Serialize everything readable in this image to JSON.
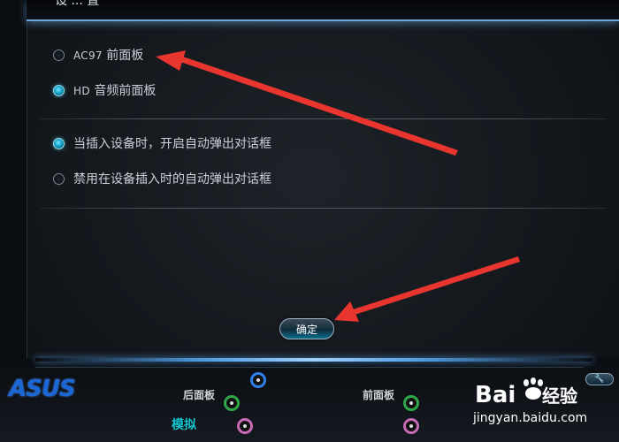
{
  "window": {
    "title_fragment": "设 ... 置"
  },
  "panel_options": [
    {
      "latin": "AC97",
      "label": " 前面板",
      "checked": false
    },
    {
      "latin": "HD",
      "label": " 音频前面板",
      "checked": true
    }
  ],
  "dialog_options": [
    {
      "label": "当插入设备时，开启自动弹出对话框",
      "checked": true
    },
    {
      "label": "禁用在设备插入时的自动弹出对话框",
      "checked": false
    }
  ],
  "ok_button": {
    "label": "确定"
  },
  "bottom": {
    "brand": "ASUS",
    "rear_panel_label": "后面板",
    "front_panel_label": "前面板",
    "analog_label": "模拟",
    "settings_icon": "wrench-icon"
  },
  "jack_colors": {
    "blue": "#2f7fe8",
    "green": "#2fa84a",
    "pink": "#c76ab6"
  },
  "annotation_color": "#e8362f",
  "watermark": {
    "brand": "Bai",
    "brand2": "du",
    "product": "经验",
    "url": "jingyan.baidu.com"
  }
}
